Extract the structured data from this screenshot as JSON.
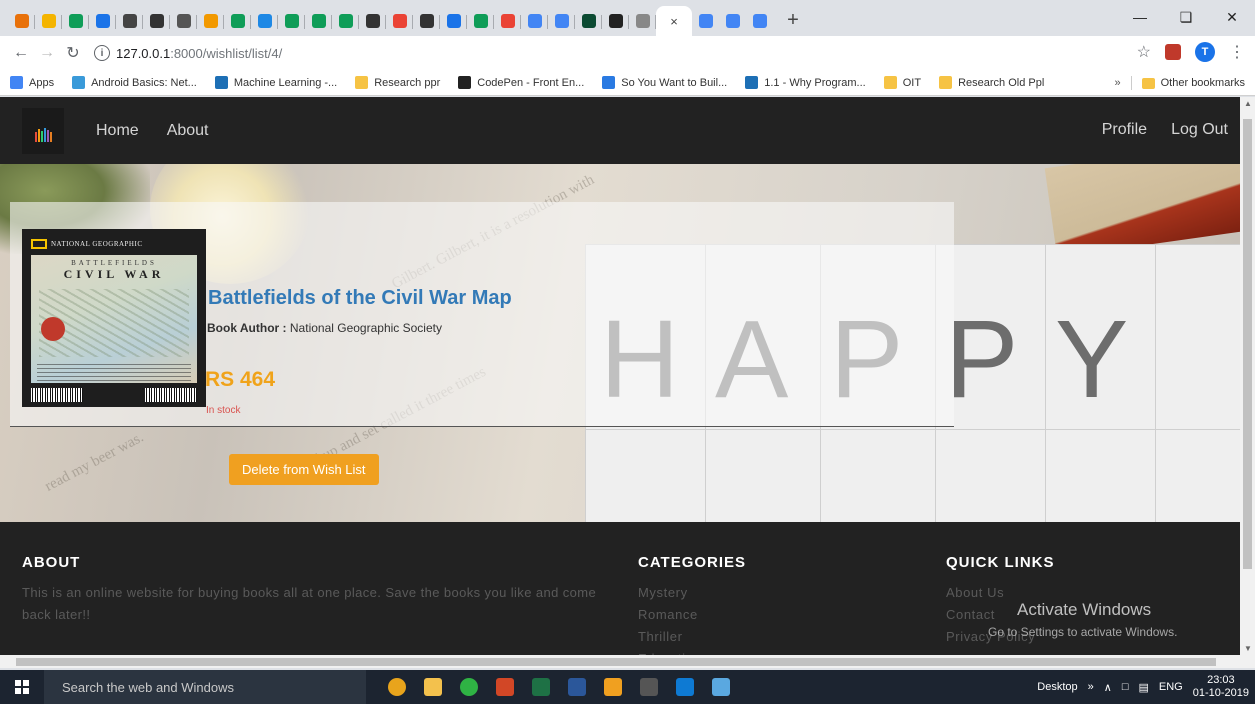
{
  "browser": {
    "active_tab_close": "×",
    "new_tab": "+",
    "url_host": "127.0.0.1",
    "url_path": ":8000/wishlist/list/4/",
    "profile_initial": "T",
    "bookmarks": [
      {
        "label": "Apps",
        "color": "#4285f4"
      },
      {
        "label": "Android Basics: Net...",
        "color": "#3a9ad9"
      },
      {
        "label": "Machine Learning -...",
        "color": "#1d6fb5"
      },
      {
        "label": "Research ppr",
        "color": "#f6c344"
      },
      {
        "label": "CodePen - Front En...",
        "color": "#222222"
      },
      {
        "label": "So You Want to Buil...",
        "color": "#2a7ae2"
      },
      {
        "label": "1.1 - Why Program...",
        "color": "#1d6fb5"
      },
      {
        "label": "OIT",
        "color": "#f6c344"
      },
      {
        "label": "Research Old Ppl",
        "color": "#f6c344"
      }
    ],
    "bookmarks_overflow": "»",
    "other_bookmarks": "Other bookmarks"
  },
  "nav": {
    "home": "Home",
    "about": "About",
    "profile": "Profile",
    "logout": "Log Out"
  },
  "hero": {
    "board_letters": [
      "H",
      "A",
      "P",
      "P",
      "Y"
    ]
  },
  "wishlist_item": {
    "title": "Battlefields of the Civil War Map",
    "author_label": "Book Author :",
    "author": "National Geographic Society",
    "price": "RS 464",
    "stock": "In stock",
    "delete_button": "Delete from Wish List",
    "cover": {
      "brand": "NATIONAL GEOGRAPHIC",
      "line1": "BATTLEFIELDS",
      "line2": "CIVIL WAR"
    }
  },
  "footer": {
    "about": {
      "heading": "ABOUT",
      "text": "This is an online website for buying books all at one place. Save the books you like and come back later!!"
    },
    "categories": {
      "heading": "CATEGORIES",
      "items": [
        "Mystery",
        "Romance",
        "Thriller",
        "Education"
      ]
    },
    "quick_links": {
      "heading": "QUICK LINKS",
      "items": [
        "About Us",
        "Contact",
        "Privacy Policy"
      ]
    }
  },
  "watermark": {
    "title": "Activate Windows",
    "subtitle": "Go to Settings to activate Windows."
  },
  "taskbar": {
    "search_placeholder": "Search the web and Windows",
    "desktop": "Desktop",
    "lang": "ENG",
    "time": "23:03",
    "date": "01-10-2019"
  }
}
